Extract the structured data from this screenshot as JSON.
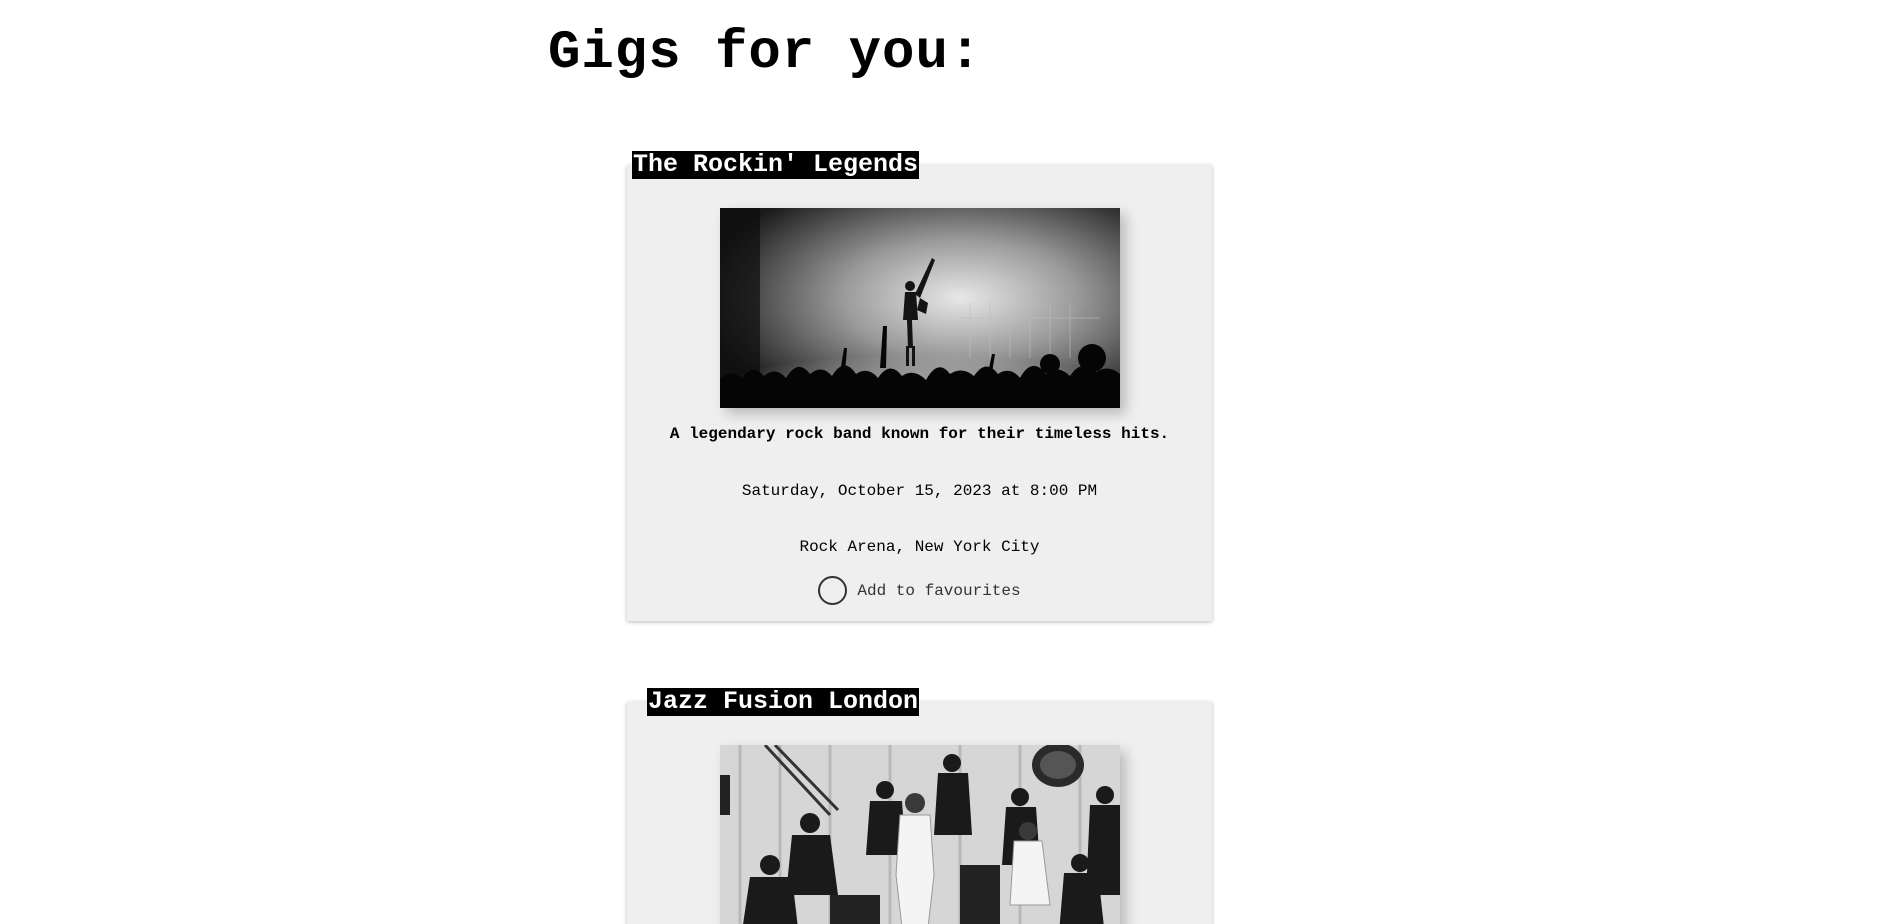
{
  "page": {
    "title": "Gigs for you:"
  },
  "gigs": [
    {
      "name": "The Rockin' Legends",
      "image_icon": "concert-photo",
      "description": "A legendary rock band known for their timeless hits.",
      "date": "Saturday, October 15, 2023 at 8:00 PM",
      "venue": "Rock Arena, New York City",
      "favourite_label": "Add to favourites"
    },
    {
      "name": "Jazz Fusion London",
      "image_icon": "band-photo"
    }
  ],
  "colors": {
    "card_background": "#efefef",
    "name_badge_background": "#000000",
    "name_badge_text": "#ffffff"
  }
}
